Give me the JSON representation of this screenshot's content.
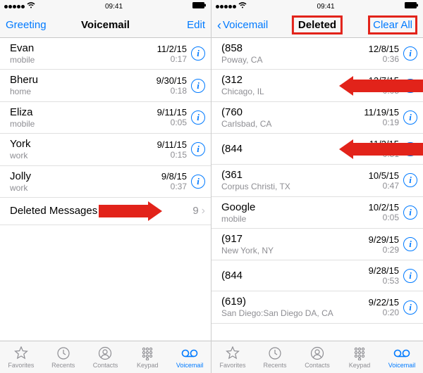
{
  "status": {
    "time": "09:41"
  },
  "left": {
    "nav": {
      "left": "Greeting",
      "title": "Voicemail",
      "right": "Edit"
    },
    "items": [
      {
        "name": "Evan",
        "sub": "mobile",
        "date": "11/2/15",
        "dur": "0:17"
      },
      {
        "name": "Bheru",
        "sub": "home",
        "date": "9/30/15",
        "dur": "0:18"
      },
      {
        "name": "Eliza",
        "sub": "mobile",
        "date": "9/11/15",
        "dur": "0:05"
      },
      {
        "name": "York",
        "sub": "work",
        "date": "9/11/15",
        "dur": "0:15"
      },
      {
        "name": "Jolly",
        "sub": "work",
        "date": "9/8/15",
        "dur": "0:37"
      }
    ],
    "deleted": {
      "label": "Deleted Messages",
      "count": "9"
    }
  },
  "right": {
    "nav": {
      "back": "Voicemail",
      "title": "Deleted",
      "right": "Clear All"
    },
    "items": [
      {
        "name": "(858",
        "sub": "Poway, CA",
        "date": "12/8/15",
        "dur": "0:36"
      },
      {
        "name": "(312",
        "sub": "Chicago, IL",
        "date": "12/7/15",
        "dur": "0:05"
      },
      {
        "name": "(760",
        "sub": "Carlsbad, CA",
        "date": "11/19/15",
        "dur": "0:19"
      },
      {
        "name": "(844",
        "sub": "",
        "date": "11/2/15",
        "dur": "0:51"
      },
      {
        "name": "(361",
        "sub": "Corpus Christi, TX",
        "date": "10/5/15",
        "dur": "0:47"
      },
      {
        "name": "Google",
        "sub": "mobile",
        "date": "10/2/15",
        "dur": "0:05"
      },
      {
        "name": "(917",
        "sub": "New York, NY",
        "date": "9/29/15",
        "dur": "0:29"
      },
      {
        "name": "(844",
        "sub": "",
        "date": "9/28/15",
        "dur": "0:53"
      },
      {
        "name": "(619)",
        "sub": "San Diego:San Diego DA, CA",
        "date": "9/22/15",
        "dur": "0:20"
      }
    ]
  },
  "tabs": {
    "favorites": "Favorites",
    "recents": "Recents",
    "contacts": "Contacts",
    "keypad": "Keypad",
    "voicemail": "Voicemail"
  }
}
